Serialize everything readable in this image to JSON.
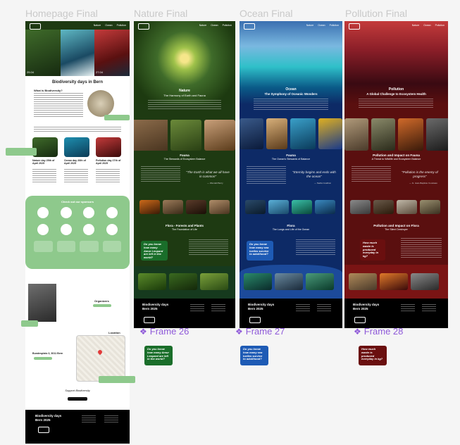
{
  "frames": {
    "homepage": {
      "title": "Homepage Final",
      "hero_title": "Biodiversity days in Bern",
      "what_heading": "What is Biodiversity?",
      "events": [
        {
          "title": "Nature day 25th of April 2025"
        },
        {
          "title": "Ocean day 26th of April 2025"
        },
        {
          "title": "Pollution day 27th of April 2025"
        }
      ],
      "check_label": "Check out our sponsors",
      "organizers_label": "Organizers",
      "location_label": "Location",
      "address": "Bundesplatz 3, 3011 Bern",
      "support_heading": "Support Biodiversity",
      "footer_title": "Biodiversity days Bern 2025",
      "date_left": "25.04",
      "date_right": "27.04"
    },
    "nature": {
      "title": "Nature Final",
      "frame_label": "Frame 26",
      "hero_title": "Nature",
      "hero_sub": "The Harmony of Earth and Fauna",
      "fauna_title": "Fauna",
      "fauna_sub": "The Stewards of Ecosystem Balance",
      "quote": "\"The Earth is what we all have in common\"",
      "quote_author": "— Wendell Berry",
      "flora_title": "Flora - Forests and Plants",
      "flora_sub": "The Foundation of Life",
      "tip": "Do you know how many Amur Leopard are left in the world?",
      "footer_title": "Biodiversity days Bern 2025"
    },
    "ocean": {
      "title": "Ocean Final",
      "frame_label": "Frame 27",
      "hero_title": "Ocean",
      "hero_sub": "The Symphony of Oceanic Wonders",
      "fauna_title": "Fauna",
      "fauna_sub": "The Ocean's Stewards of Balance",
      "quote": "\"Eternity begins and ends with the ocean\"",
      "quote_author": "— Nadia Coalition",
      "flora_title": "Flora",
      "flora_sub": "The Lungs and Life of the Ocean",
      "tip": "Do you know how many sea turtles survive to adulthood?",
      "footer_title": "Biodiversity days Bern 2025"
    },
    "pollution": {
      "title": "Pollution Final",
      "frame_label": "Frame 28",
      "hero_title": "Pollution",
      "hero_sub": "A Global Challenge to Ecosystem Health",
      "fauna_title": "Pollution and Impact on Fauna",
      "fauna_sub": "A Threat to Wildlife and Ecosystem Balance",
      "quote": "\"Pollution is the enemy of progress\"",
      "quote_author": "— G. Jean-Baptiste Cousteau",
      "flora_title": "Pollution and Impact on Flora",
      "flora_sub": "The Silent Destroyer",
      "tip": "How much waste is produced everyday in kg?",
      "footer_title": "Biodiversity days Bern 2025"
    }
  },
  "nav": {
    "items": [
      "Nature",
      "Ocean",
      "Pollution"
    ]
  },
  "colors": {
    "nature_bg": "#1e3a12",
    "ocean_bg": "#0d2a66",
    "pollution_bg": "#5a0f0f",
    "green_accent": "#8ec98c",
    "label_purple": "#8f5ad9"
  }
}
